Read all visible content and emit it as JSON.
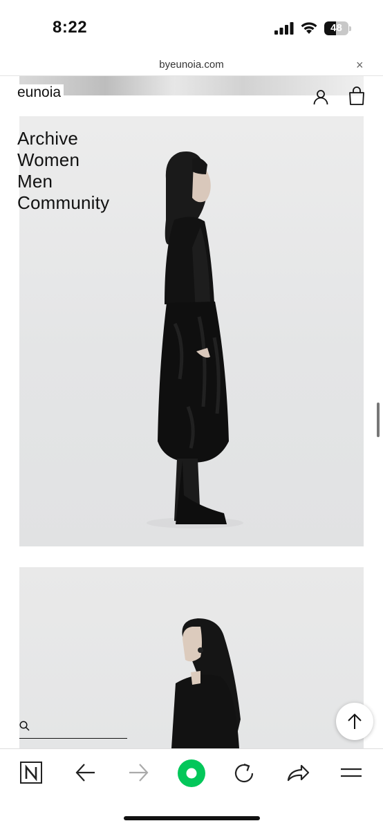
{
  "status_bar": {
    "time": "8:22",
    "battery_level": "48"
  },
  "browser": {
    "url": "byeunoia.com",
    "close_symbol": "×"
  },
  "site": {
    "logo": "eunoia",
    "menu": [
      "Archive",
      "Women",
      "Men",
      "Community"
    ]
  },
  "icons": {
    "account": "user-icon",
    "bag": "shopping-bag-icon",
    "search": "search-icon",
    "scroll_top": "arrow-up-icon"
  },
  "toolbar": [
    "naver-logo-icon",
    "back-arrow-icon",
    "forward-arrow-icon",
    "green-dot-home-icon",
    "reload-icon",
    "share-icon",
    "menu-icon"
  ],
  "colors": {
    "accent": "#03c75a",
    "text": "#111111"
  }
}
